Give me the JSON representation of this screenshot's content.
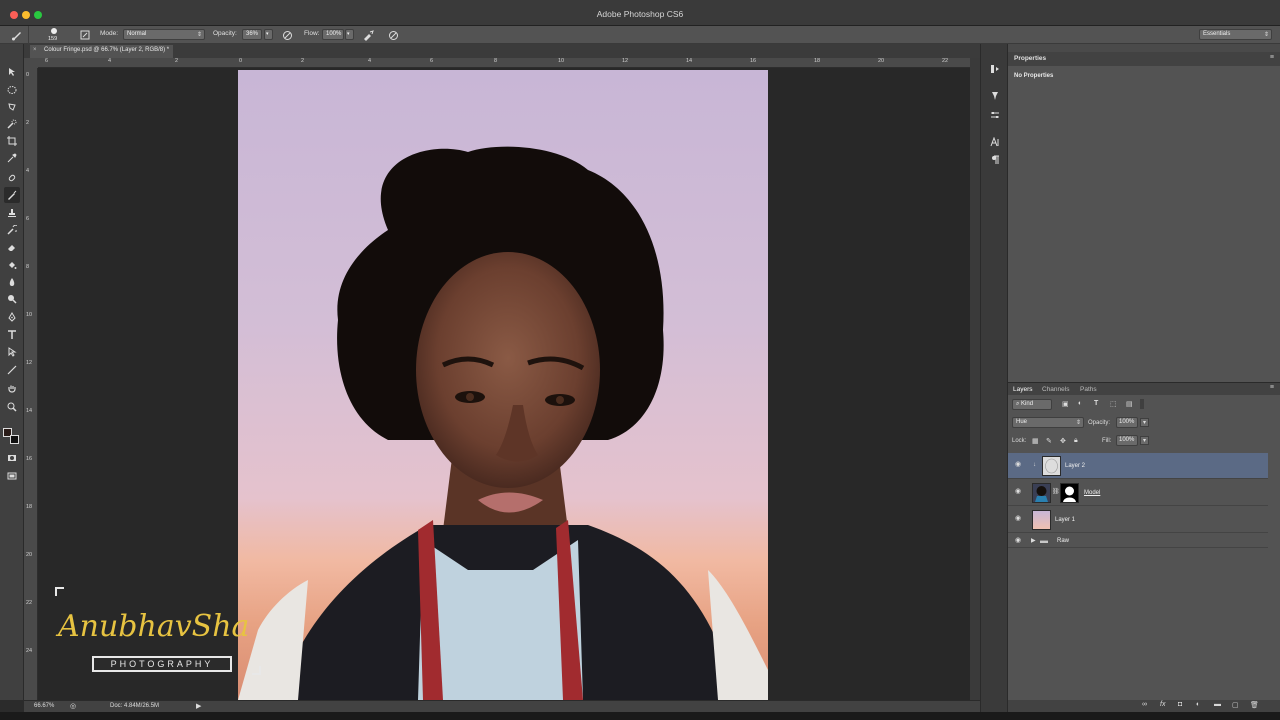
{
  "app": {
    "title": "Adobe Photoshop CS6",
    "workspace": "Essentials"
  },
  "options": {
    "brush_size": "159",
    "mode_label": "Mode:",
    "mode_value": "Normal",
    "opacity_label": "Opacity:",
    "opacity_value": "36%",
    "flow_label": "Flow:",
    "flow_value": "100%"
  },
  "document": {
    "tab_title": "Colour Fringe.psd @ 66.7% (Layer 2, RGB/8) *",
    "close": "×",
    "zoom": "66.67%",
    "doc_size": "Doc: 4.84M/26.5M"
  },
  "rulers": {
    "horizontal": [
      "6",
      "4",
      "2",
      "0",
      "2",
      "4",
      "6",
      "8",
      "10",
      "12",
      "14",
      "16",
      "18",
      "20",
      "22"
    ],
    "vertical": [
      "0",
      "2",
      "4",
      "6",
      "8",
      "10",
      "12",
      "14",
      "16",
      "18",
      "20",
      "22",
      "24"
    ]
  },
  "panels": {
    "properties": {
      "title": "Properties",
      "content": "No Properties"
    },
    "layers": {
      "tabs": [
        "Layers",
        "Channels",
        "Paths"
      ],
      "filter_label": "Kind",
      "blend_mode": "Hue",
      "opacity_label": "Opacity:",
      "opacity_value": "100%",
      "lock_label": "Lock:",
      "fill_label": "Fill:",
      "fill_value": "100%",
      "items": [
        {
          "name": "Layer 2",
          "selected": true
        },
        {
          "name": "Model",
          "selected": false
        },
        {
          "name": "Layer 1",
          "selected": false
        },
        {
          "name": "Raw",
          "selected": false
        }
      ]
    }
  },
  "watermark": {
    "signature": "AnubhavSha",
    "tagline": "PHOTOGRAPHY"
  },
  "colors": {
    "selection": "#5b6a85",
    "panel": "#535353",
    "accent_gold": "#e7c341"
  }
}
